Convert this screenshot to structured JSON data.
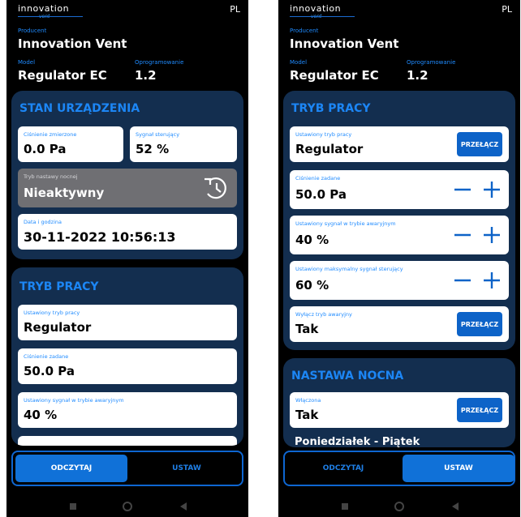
{
  "common": {
    "logo": "innovation",
    "logo_sub": "vent",
    "lang": "PL",
    "producer_label": "Producent",
    "producer_value": "Innovation Vent",
    "model_label": "Model",
    "model_value": "Regulator EC",
    "firmware_label": "Oprogramowanie",
    "firmware_value": "1.2",
    "switch_label": "PRZEŁĄCZ"
  },
  "left": {
    "status_title": "STAN URZĄDZENIA",
    "pressure_label": "Ciśnienie zmierzone",
    "pressure_value": "0.0 Pa",
    "signal_label": "Sygnał sterujący",
    "signal_value": "52 %",
    "night_label": "Tryb nastawy nocnej",
    "night_value": "Nieaktywny",
    "datetime_label": "Data i godzina",
    "datetime_value": "30-11-2022  10:56:13",
    "mode_title": "TRYB PRACY",
    "set_mode_label": "Ustawiony tryb pracy",
    "set_mode_value": "Regulator",
    "set_pressure_label": "Ciśnienie zadane",
    "set_pressure_value": "50.0 Pa",
    "emergency_signal_label": "Ustawiony sygnał w trybie awaryjnym",
    "emergency_signal_value": "40 %",
    "tab_read": "ODCZYTAJ",
    "tab_set": "USTAW"
  },
  "right": {
    "mode_title": "TRYB PRACY",
    "set_mode_label": "Ustawiony tryb pracy",
    "set_mode_value": "Regulator",
    "set_pressure_label": "Ciśnienie zadane",
    "set_pressure_value": "50.0 Pa",
    "emergency_signal_label": "Ustawiony sygnał w trybie awaryjnym",
    "emergency_signal_value": "40 %",
    "max_signal_label": "Ustawiony maksymalny sygnał sterujący",
    "max_signal_value": "60 %",
    "disable_emergency_label": "Wyłącz tryb awaryjny",
    "disable_emergency_value": "Tak",
    "night_title": "NASTAWA NOCNA",
    "enabled_label": "Włączona",
    "enabled_value": "Tak",
    "days": "Poniedziałek - Piątek",
    "tab_read": "ODCZYTAJ",
    "tab_set": "USTAW"
  },
  "colors": {
    "accent": "#1c86f5",
    "panel": "#132e4f",
    "button": "#0d63c8"
  }
}
